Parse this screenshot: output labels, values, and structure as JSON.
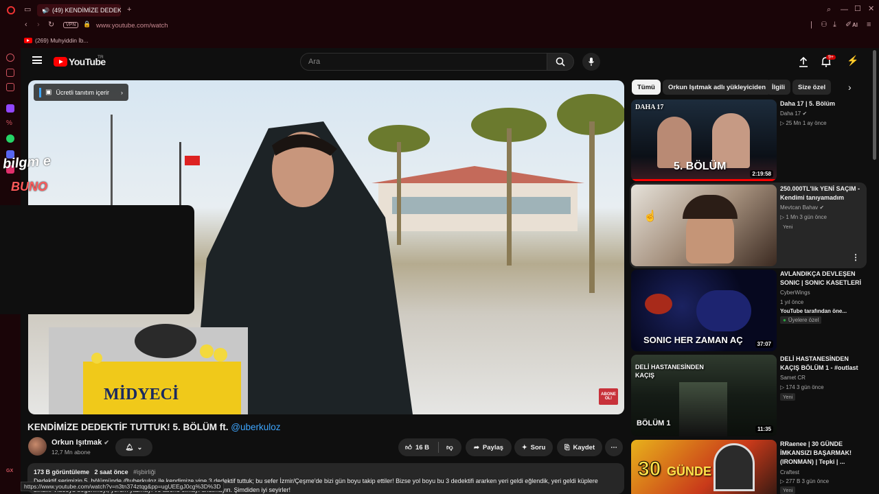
{
  "browser": {
    "tab_title": "(49) KENDİMİZE DEDEK",
    "address": "www.youtube.com/watch",
    "vpn_label": "VPN",
    "bookmark_label": "(269) Muhyiddin İb...",
    "ai_label": "AI",
    "gx_label": "GX"
  },
  "header": {
    "brand": "YouTube",
    "country": "TR",
    "search_placeholder": "Ara",
    "notif_count": "9+"
  },
  "video": {
    "promo_chip": "Ücretli tanıtım içerir",
    "title_main": "KENDİMİZE DEDEKTİF TUTTUK! 5. BÖLÜM ft. ",
    "title_mention": "@uberkuloz",
    "overlay_line1": "bilgm e",
    "overlay_line2": "BUNO",
    "watermark": "ABONE OL!",
    "channel": "Orkun Işıtmak",
    "subscribers": "12,7 Mn abone",
    "likes": "16 B",
    "share": "Paylaş",
    "ask": "Soru",
    "save": "Kaydet",
    "views": "173 B görüntüleme",
    "time_ago": "2 saat önce",
    "tag": "#işbirliği",
    "desc_line1": "Dedektif serimizin 5. bölümünde @uberkuloz ile kendimize yine 3 dedektif tuttuk; bu sefer İzmir/Çeşme'de bizi gün boyu takip ettiler! Bizse yol boyu bu 3 dedektifi ararken yeri geldi eğlendik, yeri geldi küplere",
    "desc_line2": "bindik! Videoyu beğenmeyi, yorum yazmayı ve abone olmayı unutmayın. Şimdiden iyi seyirler!",
    "status_url": "https://www.youtube.com/watch?v=n3tn374ztqg&pp=ugUEEgJ0cg%3D%3D"
  },
  "chips": [
    "Tümü",
    "Orkun Işıtmak adlı yükleyiciden",
    "İlgili",
    "Size özel"
  ],
  "recs": [
    {
      "title": "Daha 17 | 5. Bölüm",
      "channel": "Daha 17",
      "meta": "▷ 25 Mn   1 ay önce",
      "duration": "2:19:58",
      "thumb_caption": "5. BÖLÜM",
      "thumb_top": "DAHA 17"
    },
    {
      "title": "250.000TL'lik YENİ SAÇIM - Kendimi tanıyamadım",
      "channel": "Mevtcan Bahav",
      "meta": "▷ 1 Mn   3 gün önce",
      "badge": "Yeni"
    },
    {
      "title": "AVLANDIKÇA DEVLEŞEN SONIC | SONIC KASETLERİ",
      "channel": "CyberWings",
      "meta": "1 yıl önce",
      "extra": "YouTube tarafından öne...",
      "member": "Üyelere özel",
      "duration": "37:07",
      "thumb_caption": "SONIC HER ZAMAN AÇ"
    },
    {
      "title": "DELİ HASTANESİNDEN KAÇIŞ BÖLÜM 1 - #outlast",
      "channel": "Samet CR",
      "meta": "▷ 174   3 gün önce",
      "badge": "Yeni",
      "duration": "11:35",
      "thumb_caption": "DELİ HASTANESİNDEN KAÇIŞ",
      "thumb_sub": "BÖLÜM 1"
    },
    {
      "title": "RRaenee | 30 GÜNDE İMKANSIZI BAŞARMAK! (IRONMAN) | Tepki | ...",
      "channel": "Craftest",
      "meta": "▷ 277 B   3 gün önce",
      "badge": "Yeni",
      "thumb_caption": "30",
      "thumb_caption2": "GÜNDE"
    }
  ]
}
